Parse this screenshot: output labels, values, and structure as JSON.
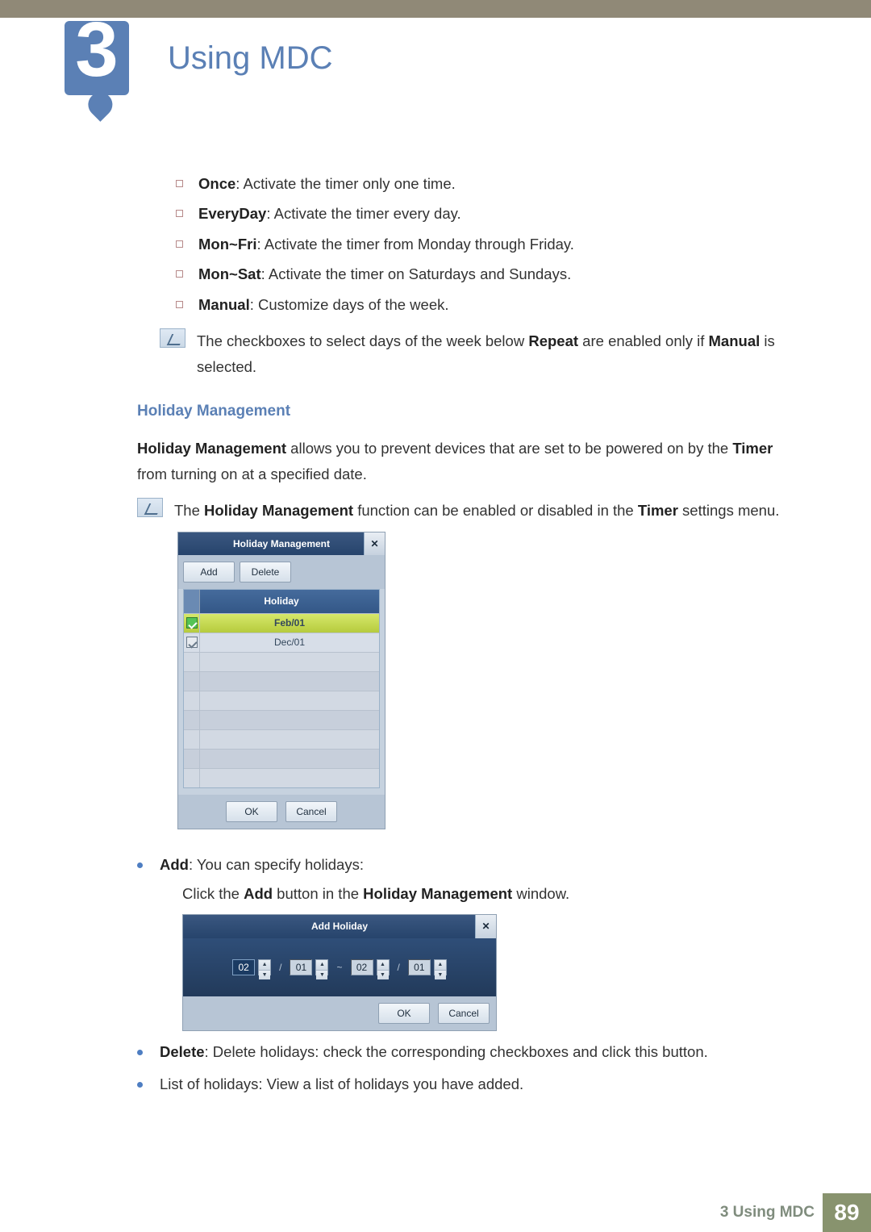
{
  "chapter": {
    "number": "3",
    "title": "Using MDC"
  },
  "repeat_options": [
    {
      "name": "Once",
      "desc": ": Activate the timer only one time."
    },
    {
      "name": "EveryDay",
      "desc": ": Activate the timer every day."
    },
    {
      "name": "Mon~Fri",
      "desc": ": Activate the timer from Monday through Friday."
    },
    {
      "name": "Mon~Sat",
      "desc": ": Activate the timer on Saturdays and Sundays."
    },
    {
      "name": "Manual",
      "desc": ": Customize days of the week."
    }
  ],
  "note1_pre": "The checkboxes to select days of the week below ",
  "note1_b1": "Repeat",
  "note1_mid": " are enabled only if ",
  "note1_b2": "Manual",
  "note1_post": " is selected.",
  "hm_heading": "Holiday Management",
  "hm_para_b1": "Holiday Management",
  "hm_para_mid": " allows you to prevent devices that are set to be powered on by the ",
  "hm_para_b2": "Timer",
  "hm_para_post": " from turning on at a specified date.",
  "note2_pre": "The ",
  "note2_b1": "Holiday Management",
  "note2_mid": " function can be enabled or disabled in the ",
  "note2_b2": "Timer",
  "note2_post": " settings menu.",
  "hm_dialog": {
    "title": "Holiday Management",
    "add": "Add",
    "delete": "Delete",
    "col": "Holiday",
    "rows": [
      {
        "val": "Feb/01",
        "selected": true
      },
      {
        "val": "Dec/01",
        "selected": false
      }
    ],
    "ok": "OK",
    "cancel": "Cancel"
  },
  "add_item_b": "Add",
  "add_item_rest": ": You can specify holidays:",
  "add_sub_pre": "Click the ",
  "add_sub_b1": "Add",
  "add_sub_mid": " button in the ",
  "add_sub_b2": "Holiday Management",
  "add_sub_post": " window.",
  "ah_dialog": {
    "title": "Add Holiday",
    "m1": "02",
    "d1": "01",
    "m2": "02",
    "d2": "01",
    "tilde": "~",
    "slash": "/",
    "ok": "OK",
    "cancel": "Cancel"
  },
  "delete_item_b": "Delete",
  "delete_item_rest": ": Delete holidays: check the corresponding checkboxes and click this button.",
  "list_item": "List of holidays: View a list of holidays you have added.",
  "footer": {
    "label": "3 Using MDC",
    "page": "89"
  }
}
